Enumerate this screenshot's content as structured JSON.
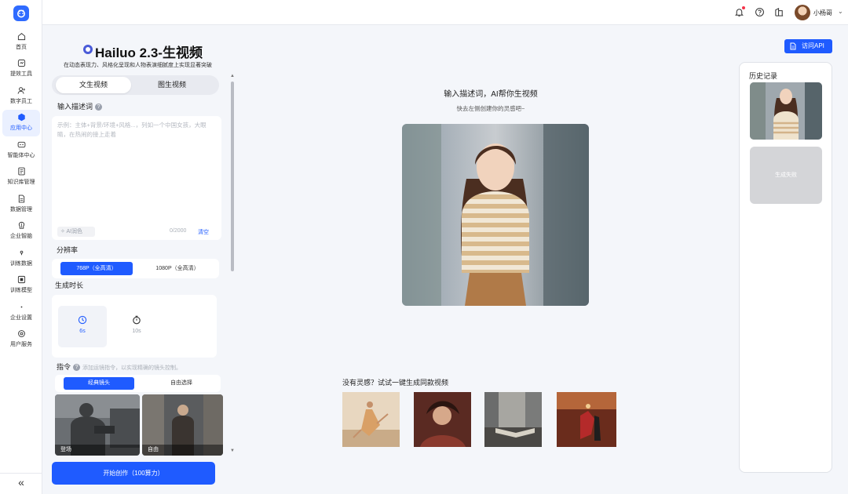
{
  "nav": {
    "items": [
      {
        "label": "首页",
        "icon": "home-icon"
      },
      {
        "label": "提效工具",
        "icon": "tools-icon"
      },
      {
        "label": "数字员工",
        "icon": "digital-employee-icon"
      },
      {
        "label": "应用中心",
        "icon": "app-center-icon",
        "active": true
      },
      {
        "label": "智能体中心",
        "icon": "agent-icon"
      },
      {
        "label": "知识库管理",
        "icon": "knowledge-base-icon"
      },
      {
        "label": "数据管理",
        "icon": "data-icon"
      },
      {
        "label": "企业智脑",
        "icon": "brain-icon"
      },
      {
        "label": "训练数据",
        "icon": "training-data-icon"
      },
      {
        "label": "训练模型",
        "icon": "training-model-icon"
      },
      {
        "label": "企业设置",
        "icon": "settings-icon"
      },
      {
        "label": "用户服务",
        "icon": "user-service-icon"
      }
    ],
    "collapse_glyph": "«"
  },
  "topbar": {
    "username": "小杨哥",
    "icons": [
      "bell-icon",
      "help-icon",
      "building-icon"
    ],
    "notification_dot_color": "#f5334a"
  },
  "panel": {
    "title": "Hailuo 2.3-生视频",
    "subtitle": "在动态表现力、风格化呈现和人物表演细腻度上实现显著突破",
    "tabs": [
      "文生视频",
      "图生视频"
    ],
    "prompt_label": "输入描述词",
    "prompt_placeholder": "示例：主体+背景/环境+风格...，列如一个中国女孩，大眼睛，在热闹的接上走着",
    "ai_polish": "AI润色",
    "char_count": "0/2000",
    "clear": "清空",
    "resolution_label": "分辨率",
    "resolutions": [
      "768P（全高清）",
      "1080P（全高清）"
    ],
    "duration_label": "生成时长",
    "durations": [
      "6s",
      "10s"
    ],
    "command_label": "指令",
    "command_hint": "添加运镜指令，以实现精确的镜头控制。",
    "camera_tabs": [
      "经典镜头",
      "自由选择"
    ],
    "camera_presets": [
      "登场",
      "自由"
    ],
    "cta": "开始创作（100算力）"
  },
  "center": {
    "api_button": "访问API",
    "title": "输入描述词，AI帮你生视频",
    "subtitle": "快去左侧创建你的灵感吧~",
    "inspiration_title": "没有灵感？试试一键生成同款视频"
  },
  "history": {
    "title": "历史记录",
    "failed_label": "生成失败"
  },
  "colors": {
    "accent": "#1f5bff",
    "active_nav_bg": "#eaf0ff"
  }
}
